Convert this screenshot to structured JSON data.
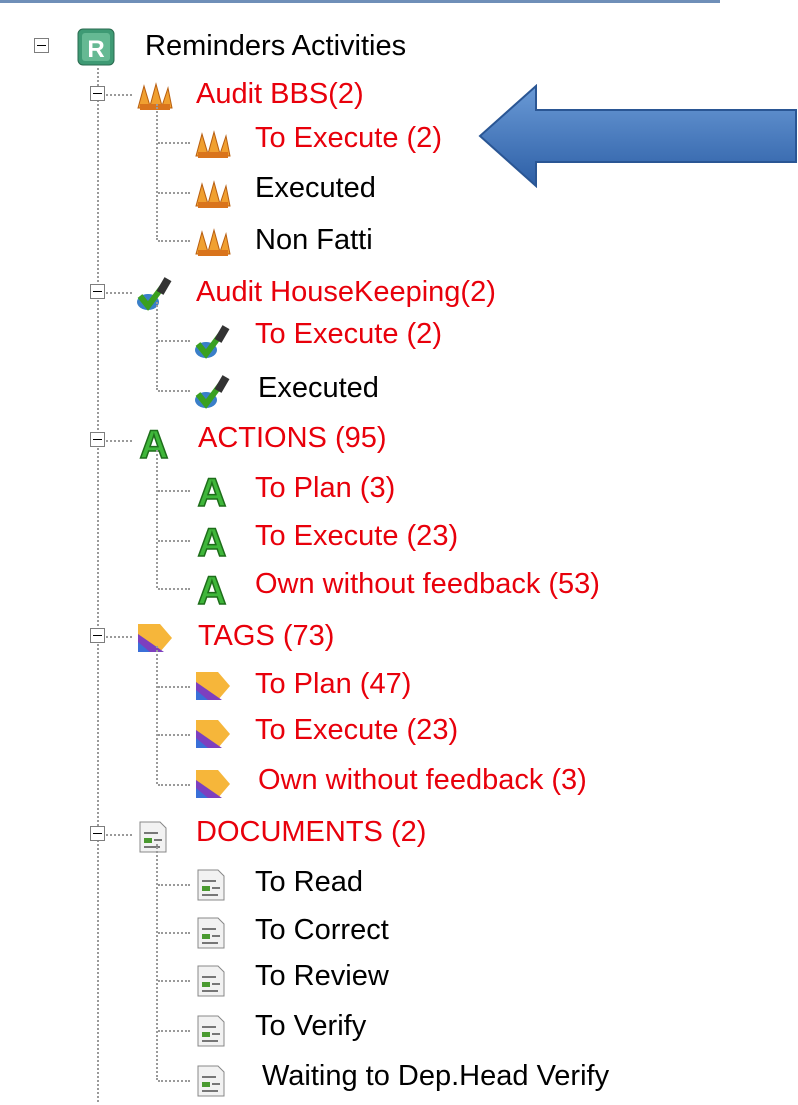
{
  "tree": {
    "root": {
      "label": "Reminders Activities",
      "icon": "reminders-r-icon"
    },
    "groups": [
      {
        "label": "Audit BBS(2)",
        "icon": "audit-bbs-icon",
        "children": [
          "To Execute (2)",
          "Executed",
          "Non Fatti"
        ]
      },
      {
        "label": "Audit HouseKeeping(2)",
        "icon": "housekeeping-icon",
        "children": [
          "To Execute (2)",
          "Executed"
        ]
      },
      {
        "label": "ACTIONS (95)",
        "icon": "actions-a-icon",
        "children": [
          "To Plan (3)",
          "To Execute (23)",
          "Own without feedback (53)"
        ]
      },
      {
        "label": "TAGS (73)",
        "icon": "tag-icon",
        "children": [
          "To Plan (47)",
          "To Execute (23)",
          "Own without feedback (3)"
        ]
      },
      {
        "label": "DOCUMENTS (2)",
        "icon": "document-icon",
        "children": [
          "To Read",
          "To Correct",
          "To Review",
          "To Verify",
          "Waiting to Dep.Head Verify"
        ]
      }
    ]
  },
  "colors": {
    "highlight": "#e8000b",
    "normal": "#000000",
    "arrow": "#3a6fb5"
  }
}
